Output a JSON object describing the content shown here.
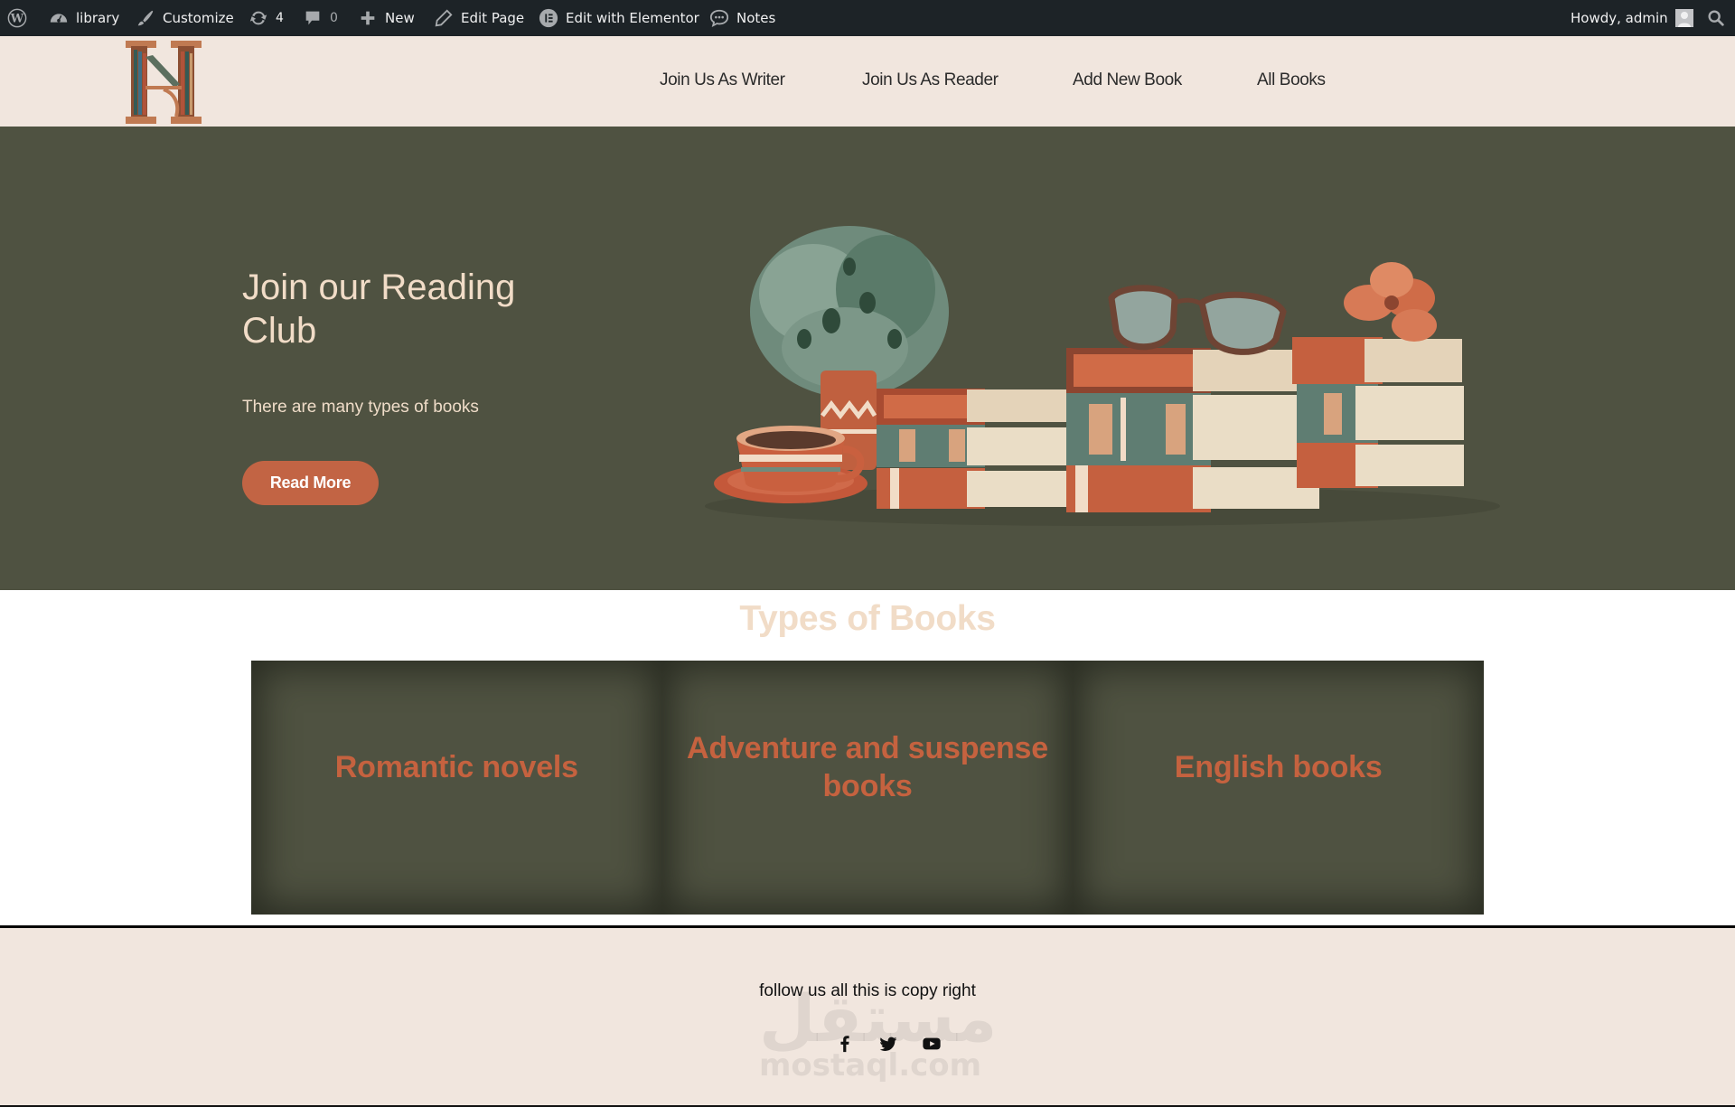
{
  "admin_bar": {
    "wp_logo_icon": "wordpress-icon",
    "site_name": "library",
    "customize": "Customize",
    "updates_count": "4",
    "comments_count": "0",
    "new": "New",
    "edit_page": "Edit Page",
    "edit_elementor": "Edit with Elementor",
    "notes": "Notes",
    "howdy": "Howdy, admin",
    "search_icon": "search-icon"
  },
  "header": {
    "logo_alt": "H bookshelf letter logo",
    "nav": [
      {
        "label": "Join Us As Writer"
      },
      {
        "label": "Join Us As Reader"
      },
      {
        "label": "Add New Book"
      },
      {
        "label": "All Books"
      }
    ]
  },
  "hero": {
    "title": "Join our Reading Club",
    "subtitle": "There are many types of books",
    "button": "Read More",
    "illustration": "books-plant-coffee-glasses-illustration"
  },
  "types": {
    "title": "Types of Books",
    "cards": [
      {
        "label": "Romantic novels"
      },
      {
        "label": "Adventure and suspense books"
      },
      {
        "label": "English books"
      }
    ]
  },
  "footer": {
    "text": "follow us all this is copy right",
    "social": [
      "facebook-icon",
      "twitter-icon",
      "youtube-icon"
    ],
    "watermark_ar": "مستقل",
    "watermark_en": "mostaql.com"
  },
  "colors": {
    "admin_bar_bg": "#1d2327",
    "header_bg": "#f1e6de",
    "hero_bg": "#4f5241",
    "accent": "#c26444",
    "cream_text": "#f1dcc7"
  }
}
